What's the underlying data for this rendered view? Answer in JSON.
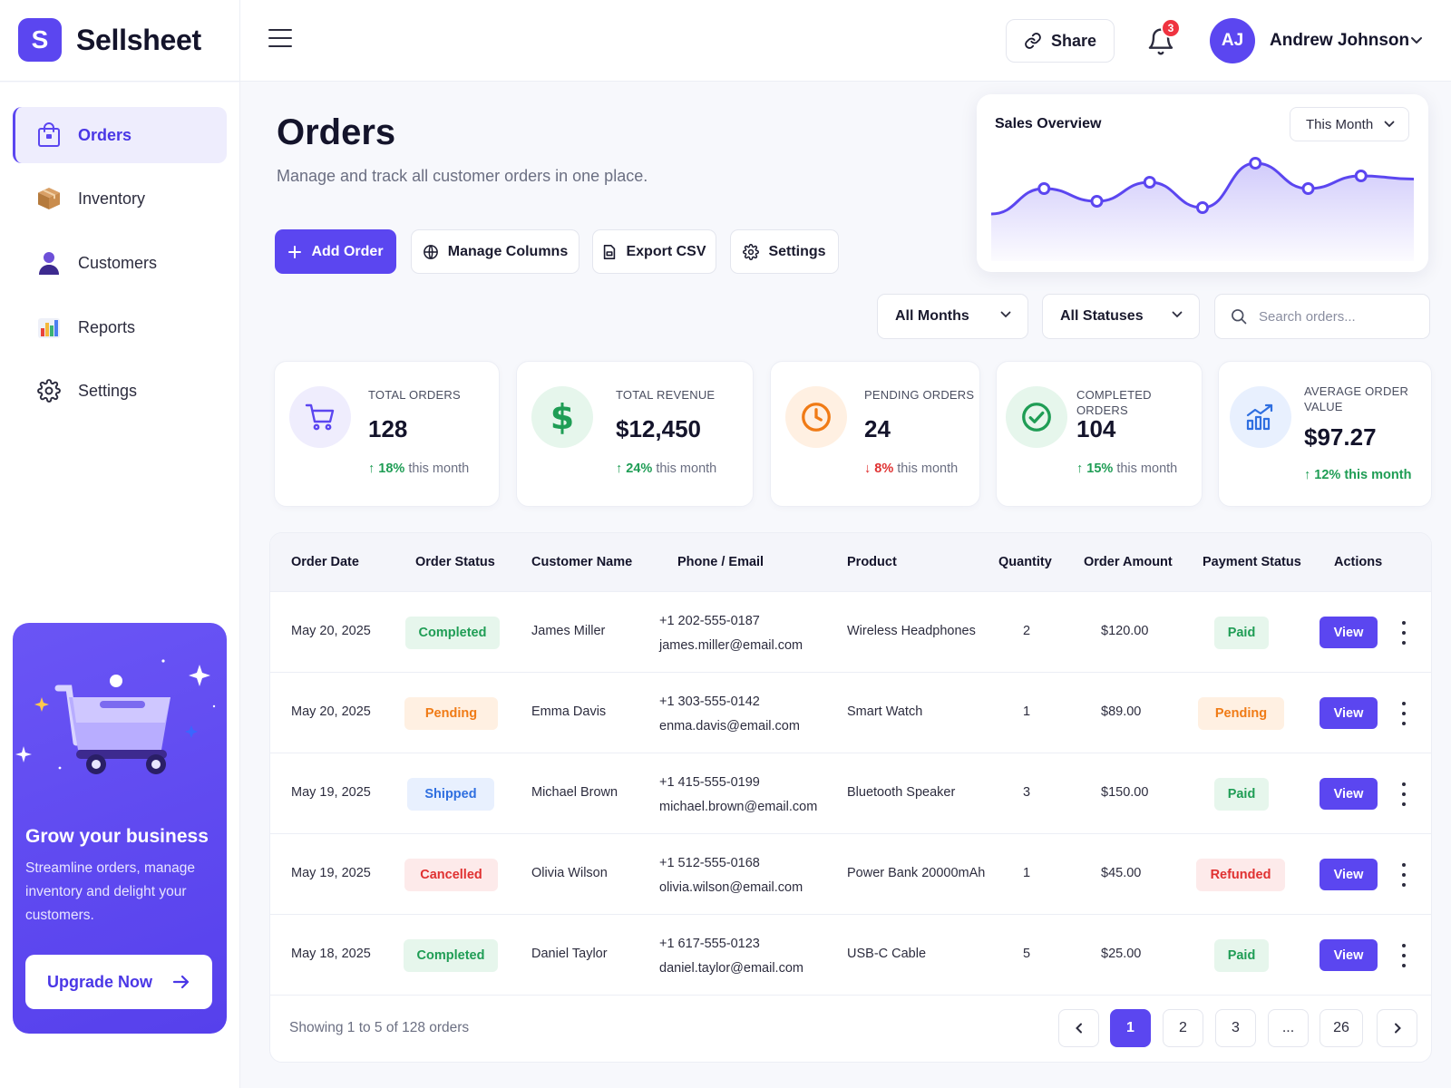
{
  "app": {
    "logo_letter": "S",
    "name": "Sellsheet"
  },
  "header": {
    "share_label": "Share",
    "notification_count": "3",
    "user_initials": "AJ",
    "user_name": "Andrew Johnson"
  },
  "sidebar": {
    "items": [
      {
        "label": "Orders",
        "icon": "shopping-bag-icon",
        "active": true
      },
      {
        "label": "Inventory",
        "icon": "box-icon"
      },
      {
        "label": "Customers",
        "icon": "person-icon"
      },
      {
        "label": "Reports",
        "icon": "bar-chart-icon"
      },
      {
        "label": "Settings",
        "icon": "gear-icon"
      }
    ],
    "promo": {
      "title": "Grow your business",
      "text": "Streamline orders, manage inventory and delight your customers.",
      "button": "Upgrade Now"
    }
  },
  "page": {
    "title": "Orders",
    "subtitle": "Manage and track all customer orders in one place."
  },
  "actions": {
    "add_order": "Add Order",
    "manage_columns": "Manage Columns",
    "export_csv": "Export CSV",
    "settings": "Settings"
  },
  "sales_overview": {
    "title": "Sales Overview",
    "period": "This Month",
    "points": [
      2,
      6,
      4,
      7,
      3,
      10,
      6,
      8,
      7.5
    ],
    "accent": "#5b46f0"
  },
  "filters": {
    "months": "All Months",
    "statuses": "All Statuses",
    "search_placeholder": "Search orders..."
  },
  "stats": [
    {
      "label": "TOTAL ORDERS",
      "value": "128",
      "delta": "18%",
      "delta_suffix": "this month",
      "direction": "up",
      "icon": "cart-icon"
    },
    {
      "label": "TOTAL REVENUE",
      "value": "$12,450",
      "delta": "24%",
      "delta_suffix": "this month",
      "direction": "up",
      "icon": "dollar-icon"
    },
    {
      "label": "PENDING ORDERS",
      "value": "24",
      "delta": "8%",
      "delta_suffix": "this month",
      "direction": "down",
      "icon": "clock-icon"
    },
    {
      "label": "COMPLETED ORDERS",
      "value": "104",
      "delta": "15%",
      "delta_suffix": "this month",
      "direction": "up",
      "icon": "check-circle-icon"
    },
    {
      "label": "AVERAGE ORDER VALUE",
      "value": "$97.27",
      "delta": "12% this month",
      "direction": "up",
      "icon": "trend-chart-icon"
    }
  ],
  "table": {
    "columns": [
      "Order Date",
      "Order Status",
      "Customer Name",
      "Phone / Email",
      "Product",
      "Quantity",
      "Order Amount",
      "Payment Status",
      "Actions"
    ],
    "rows": [
      {
        "date": "May 20, 2025",
        "status": "Completed",
        "customer": "James Miller",
        "phone": "+1 202-555-0187",
        "email": "james.miller@email.com",
        "product": "Wireless Headphones",
        "qty": "2",
        "amount": "$120.00",
        "payment": "Paid",
        "action": "View"
      },
      {
        "date": "May 20, 2025",
        "status": "Pending",
        "customer": "Emma Davis",
        "phone": "+1 303-555-0142",
        "email": "enma.davis@email.com",
        "product": "Smart Watch",
        "qty": "1",
        "amount": "$89.00",
        "payment": "Pending",
        "action": "View"
      },
      {
        "date": "May 19, 2025",
        "status": "Shipped",
        "customer": "Michael Brown",
        "phone": "+1 415-555-0199",
        "email": "michael.brown@email.com",
        "product": "Bluetooth Speaker",
        "qty": "3",
        "amount": "$150.00",
        "payment": "Paid",
        "action": "View"
      },
      {
        "date": "May 19, 2025",
        "status": "Cancelled",
        "customer": "Olivia Wilson",
        "phone": "+1 512-555-0168",
        "email": "olivia.wilson@email.com",
        "product": "Power Bank 20000mAh",
        "qty": "1",
        "amount": "$45.00",
        "payment": "Refunded",
        "action": "View"
      },
      {
        "date": "May 18, 2025",
        "status": "Completed",
        "customer": "Daniel Taylor",
        "phone": "+1 617-555-0123",
        "email": "daniel.taylor@email.com",
        "product": "USB-C Cable",
        "qty": "5",
        "amount": "$25.00",
        "payment": "Paid",
        "action": "View"
      }
    ],
    "footer": "Showing 1 to 5 of 128 orders",
    "pages": [
      "1",
      "2",
      "3",
      "...",
      "26"
    ]
  },
  "colors": {
    "accent": "#5b46f0",
    "success": "#1f9d55",
    "warning": "#f07b16",
    "info": "#2f6fe0",
    "danger": "#e03131"
  }
}
